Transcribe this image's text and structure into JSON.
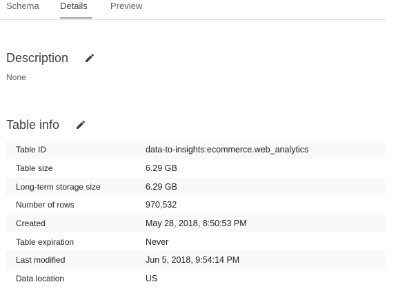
{
  "tabs": [
    {
      "label": "Schema"
    },
    {
      "label": "Details"
    },
    {
      "label": "Preview"
    }
  ],
  "active_tab": "Details",
  "description": {
    "title": "Description",
    "value": "None"
  },
  "table_info": {
    "title": "Table info",
    "rows": [
      {
        "label": "Table ID",
        "value": "data-to-insights:ecommerce.web_analytics"
      },
      {
        "label": "Table size",
        "value": "6.29 GB"
      },
      {
        "label": "Long-term storage size",
        "value": "6.29 GB"
      },
      {
        "label": "Number of rows",
        "value": "970,532"
      },
      {
        "label": "Created",
        "value": "May 28, 2018, 8:50:53 PM"
      },
      {
        "label": "Table expiration",
        "value": "Never"
      },
      {
        "label": "Last modified",
        "value": "Jun 5, 2018, 9:54:14 PM"
      },
      {
        "label": "Data location",
        "value": "US"
      }
    ]
  },
  "icons": {
    "edit": "pencil-icon"
  },
  "colors": {
    "text": "#202124",
    "muted": "#5f6368",
    "row_shade": "#f8f9fa",
    "divider": "#dadce0"
  }
}
